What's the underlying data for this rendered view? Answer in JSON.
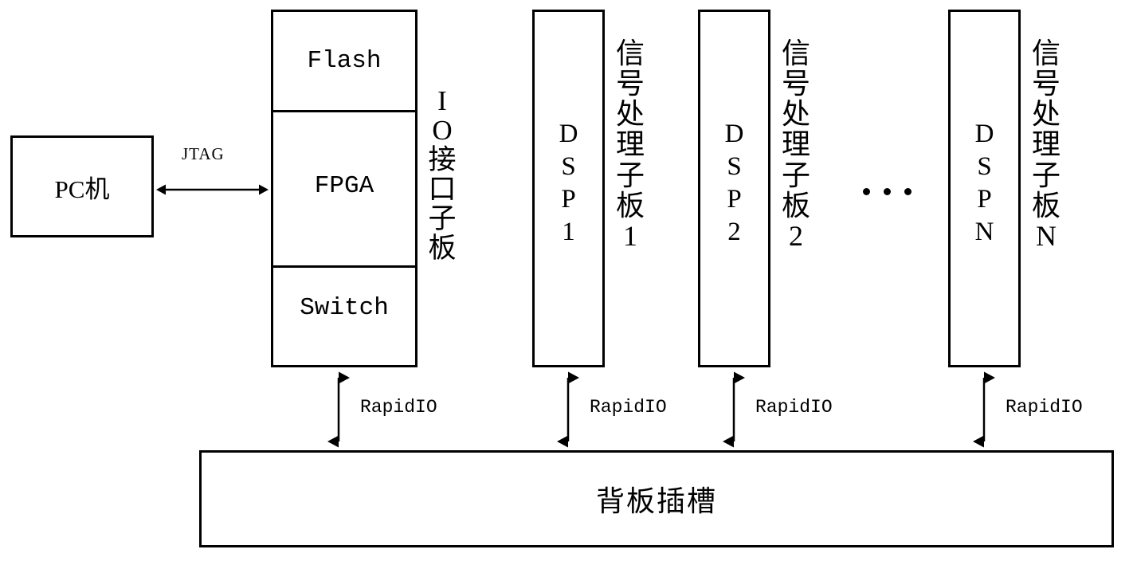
{
  "diagram": {
    "title_text_present": false,
    "pc_box": {
      "label": "PC机"
    },
    "jtag_link": {
      "label": "JTAG"
    },
    "io_board": {
      "sections": [
        {
          "label": "Flash"
        },
        {
          "label": "FPGA"
        },
        {
          "label": "Switch"
        }
      ],
      "side_label_chars": [
        "I",
        "O",
        "接",
        "口",
        "子",
        "板"
      ],
      "side_label": "IO接口子板"
    },
    "dsp_boards": [
      {
        "inner_label_chars": [
          "D",
          "S",
          "P",
          "1"
        ],
        "inner_label": "DSP1",
        "side_label_chars": [
          "信",
          "号",
          "处",
          "理",
          "子",
          "板",
          "1"
        ],
        "side_label": "信号处理子板1"
      },
      {
        "inner_label_chars": [
          "D",
          "S",
          "P",
          "2"
        ],
        "inner_label": "DSP2",
        "side_label_chars": [
          "信",
          "号",
          "处",
          "理",
          "子",
          "板",
          "2"
        ],
        "side_label": "信号处理子板2"
      },
      {
        "inner_label_chars": [
          "D",
          "S",
          "P",
          "N"
        ],
        "inner_label": "DSPN",
        "side_label_chars": [
          "信",
          "号",
          "处",
          "理",
          "子",
          "板",
          "N"
        ],
        "side_label": "信号处理子板N"
      }
    ],
    "ellipsis": {
      "label": "...",
      "dot_count": 3
    },
    "rapidio_links": [
      {
        "label": "RapidIO"
      },
      {
        "label": "RapidIO"
      },
      {
        "label": "RapidIO"
      },
      {
        "label": "RapidIO"
      }
    ],
    "backplane": {
      "label": "背板插槽"
    },
    "colors": {
      "stroke": "#000000",
      "background": "#ffffff",
      "text": "#000000"
    }
  }
}
